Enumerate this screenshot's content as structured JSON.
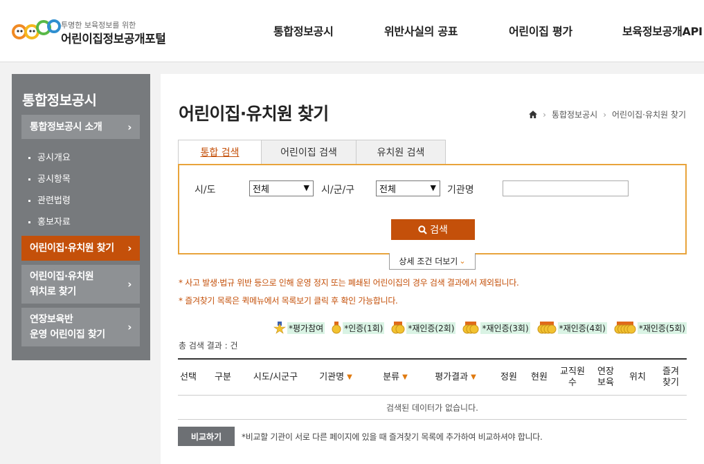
{
  "header": {
    "logo_sub": "투명한 보육정보를 위한",
    "logo_main": "어린이집정보공개포털",
    "nav": [
      "통합정보공시",
      "위반사실의 공표",
      "어린이집 평가",
      "보육정보공개API"
    ]
  },
  "sidebar": {
    "title": "통합정보공시",
    "intro": "통합정보공시 소개",
    "sub_items": [
      "공시개요",
      "공시항목",
      "관련법령",
      "홍보자료"
    ],
    "find": "어린이집·유치원 찾기",
    "location_line1": "어린이집·유치원",
    "location_line2": "위치로 찾기",
    "extended_line1": "연장보육반",
    "extended_line2": "운영 어린이집 찾기"
  },
  "main": {
    "title": "어린이집·유치원 찾기",
    "breadcrumb": [
      "통합정보공시",
      "어린이집·유치원 찾기"
    ],
    "tabs": [
      "통합 검색",
      "어린이집 검색",
      "유치원 검색"
    ],
    "search": {
      "sido_label": "시/도",
      "sido_value": "전체",
      "sigungu_label": "시/군/구",
      "sigungu_value": "전체",
      "name_label": "기관명",
      "name_value": "",
      "button": "검색"
    },
    "detail_button": "상세 조건 더보기",
    "notices": [
      "* 사고 발생·법규 위반 등으로 인해 운영 정지 또는 폐쇄된 어린이집의 경우 검색 결과에서 제외됩니다.",
      "* 즐겨찾기 목록은 퀵메뉴에서 목록보기 클릭 후 확인 가능합니다."
    ],
    "legend": [
      "*평가참여",
      "*인증(1회)",
      "*재인증(2회)",
      "*재인증(3회)",
      "*재인증(4회)",
      "*재인증(5회)"
    ],
    "total": "총 검색 결과 : 건",
    "table": {
      "headers": [
        "선택",
        "구분",
        "시도/시군구",
        "기관명",
        "분류",
        "평가결과",
        "정원",
        "현원",
        "교직원\n수",
        "연장\n보육",
        "위치",
        "즐겨\n찾기"
      ],
      "empty": "검색된 데이터가 없습니다."
    },
    "compare_button": "비교하기",
    "compare_note": "*비교할 기관이 서로 다른 페이지에 있을 때 즐겨찾기 목록에 추가하여 비교하셔야 합니다."
  },
  "colors": {
    "accent": "#c4500a",
    "search_border": "#e8a33a",
    "sidebar_bg": "#777a7d"
  }
}
